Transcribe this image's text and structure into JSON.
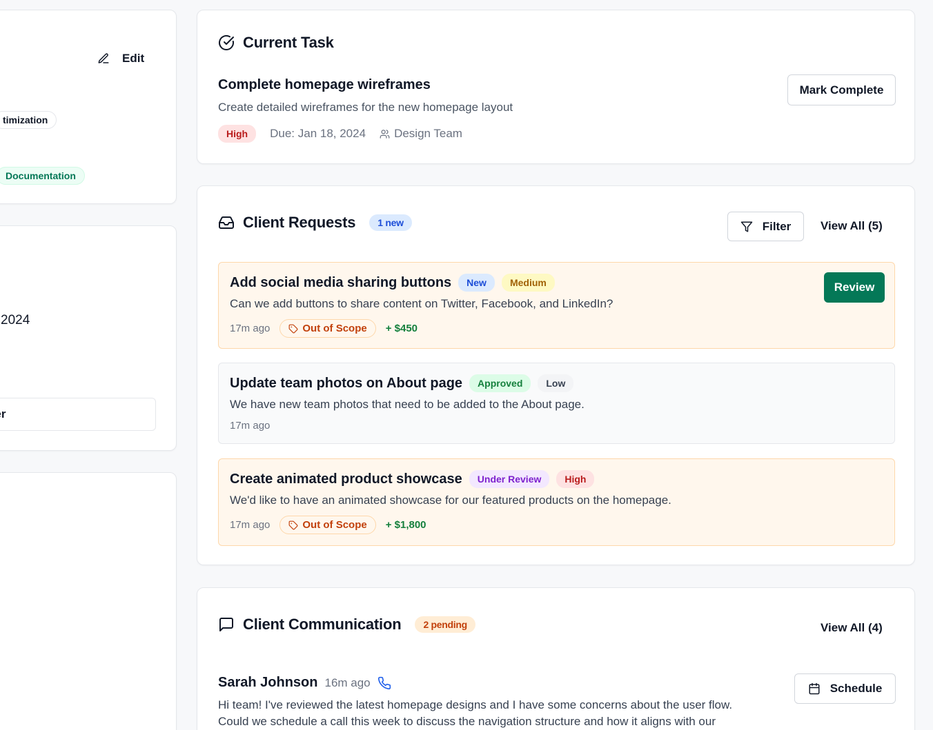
{
  "left_panel": {
    "edit_label": "Edit",
    "tag_1": "timization",
    "tag_2": "Documentation",
    "date_text": "2024",
    "field_text": "ger"
  },
  "current_task": {
    "title": "Current Task",
    "task_name": "Complete homepage wireframes",
    "task_description": "Create detailed wireframes for the new homepage layout",
    "priority": "High",
    "due": "Due: Jan 18, 2024",
    "team": "Design Team",
    "mark_complete_label": "Mark Complete"
  },
  "client_requests": {
    "title": "Client Requests",
    "new_badge": "1 new",
    "filter_label": "Filter",
    "view_all_label": "View All (5)",
    "items": [
      {
        "title": "Add social media sharing buttons",
        "status": "New",
        "priority": "Medium",
        "description": "Can we add buttons to share content on Twitter, Facebook, and LinkedIn?",
        "time": "17m ago",
        "scope": "Out of Scope",
        "amount": "+ $450",
        "action": "Review"
      },
      {
        "title": "Update team photos on About page",
        "status": "Approved",
        "priority": "Low",
        "description": "We have new team photos that need to be added to the About page.",
        "time": "17m ago"
      },
      {
        "title": "Create animated product showcase",
        "status": "Under Review",
        "priority": "High",
        "description": "We'd like to have an animated showcase for our featured products on the homepage.",
        "time": "17m ago",
        "scope": "Out of Scope",
        "amount": "+ $1,800"
      }
    ]
  },
  "client_communication": {
    "title": "Client Communication",
    "pending_badge": "2 pending",
    "view_all_label": "View All (4)",
    "message": {
      "sender": "Sarah Johnson",
      "time": "16m ago",
      "schedule_label": "Schedule",
      "body_line_1": "Hi team! I've reviewed the latest homepage designs and I have some concerns about the user flow.",
      "body_line_2": "Could we schedule a call this week to discuss the navigation structure and how it aligns with our"
    }
  },
  "colors": {
    "primary_green": "#047857",
    "out_of_scope_bg": "#fff7ed",
    "out_of_scope_border": "#fed7aa",
    "phone_icon": "#2563eb"
  }
}
